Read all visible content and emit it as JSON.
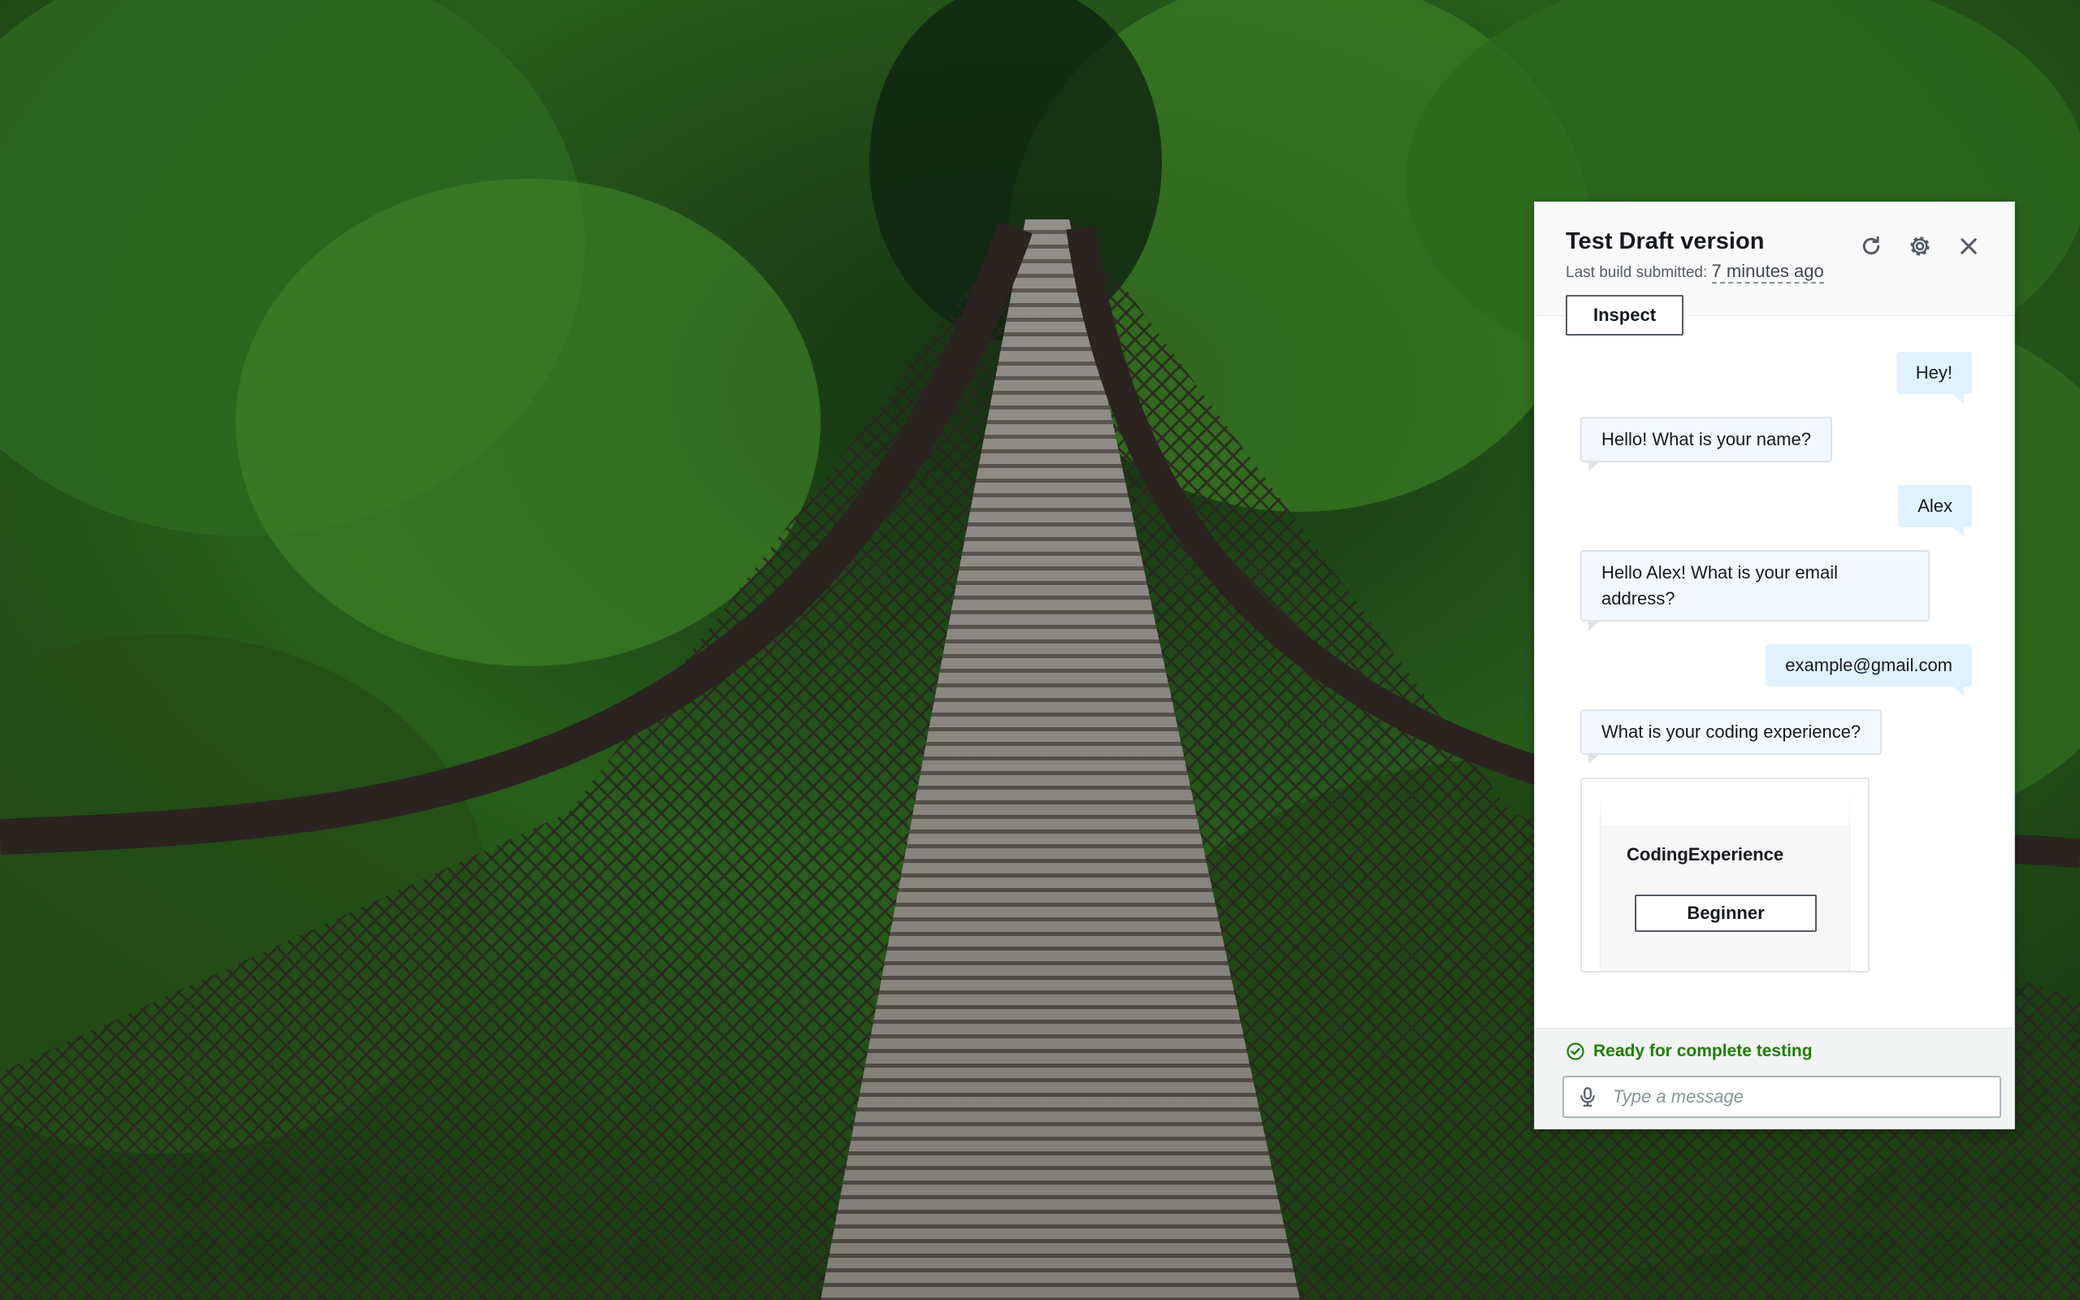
{
  "panel": {
    "title": "Test Draft version",
    "subtitle_prefix": "Last build submitted:",
    "subtitle_time": "7 minutes ago",
    "inspect_label": "Inspect",
    "icons": [
      "refresh-icon",
      "gear-icon",
      "close-icon"
    ]
  },
  "chat": {
    "messages": [
      {
        "from": "user",
        "text": "Hey!"
      },
      {
        "from": "bot",
        "text": "Hello! What is your name?"
      },
      {
        "from": "user",
        "text": "Alex"
      },
      {
        "from": "bot",
        "text": "Hello Alex! What is your email address?"
      },
      {
        "from": "user",
        "text": "example@gmail.com"
      },
      {
        "from": "bot",
        "text": "What is your coding experience?"
      }
    ],
    "card": {
      "title": "CodingExperience",
      "button_label": "Beginner"
    }
  },
  "footer": {
    "status": "Ready for complete testing",
    "status_color": "#1d8102",
    "input_placeholder": "Type a message",
    "mic_icon": "microphone-icon"
  },
  "background": {
    "description_icon": "forest-bridge-image"
  }
}
